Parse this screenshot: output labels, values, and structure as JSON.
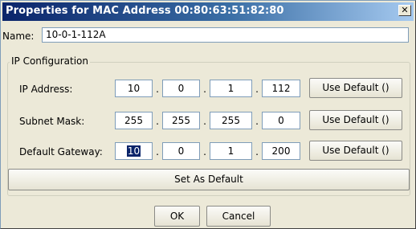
{
  "dialog": {
    "title": "Properties for MAC Address 00:80:63:51:82:80",
    "close_glyph": "✕"
  },
  "name": {
    "label": "Name:",
    "value": "10-0-1-112A"
  },
  "ip_config": {
    "legend": "IP Configuration",
    "separator": ".",
    "use_default_label": "Use Default ()",
    "rows": [
      {
        "label": "IP Address:",
        "octets": [
          "10",
          "0",
          "1",
          "112"
        ]
      },
      {
        "label": "Subnet Mask:",
        "octets": [
          "255",
          "255",
          "255",
          "0"
        ]
      },
      {
        "label": "Default Gateway:",
        "octets": [
          "10",
          "0",
          "1",
          "200"
        ],
        "selected_octet": 0
      }
    ],
    "set_default_label": "Set As Default"
  },
  "footer": {
    "ok_label": "OK",
    "cancel_label": "Cancel"
  },
  "colors": {
    "title_gradient_start": "#0a246a",
    "title_gradient_end": "#a6caf0",
    "selection": "#0a246a",
    "window_bg": "#ece9d8"
  }
}
